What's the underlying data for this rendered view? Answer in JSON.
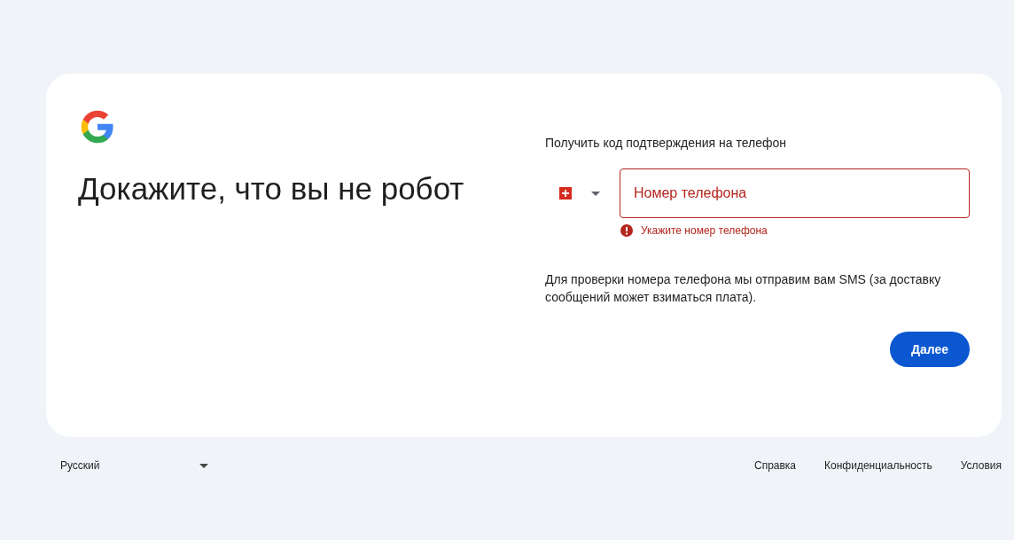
{
  "card": {
    "title": "Докажите, что вы не робот",
    "phone_prompt": "Получить код подтверждения на телефон",
    "phone_field": {
      "placeholder": "Номер телефона",
      "error": true
    },
    "error_message": "Укажите номер телефона",
    "info_text": "Для проверки номера телефона мы отправим вам SMS (за доставку сообщений может взиматься плата).",
    "next_button": "Далее"
  },
  "footer": {
    "language": "Русский",
    "links": [
      "Справка",
      "Конфиденциальность",
      "Условия"
    ]
  }
}
